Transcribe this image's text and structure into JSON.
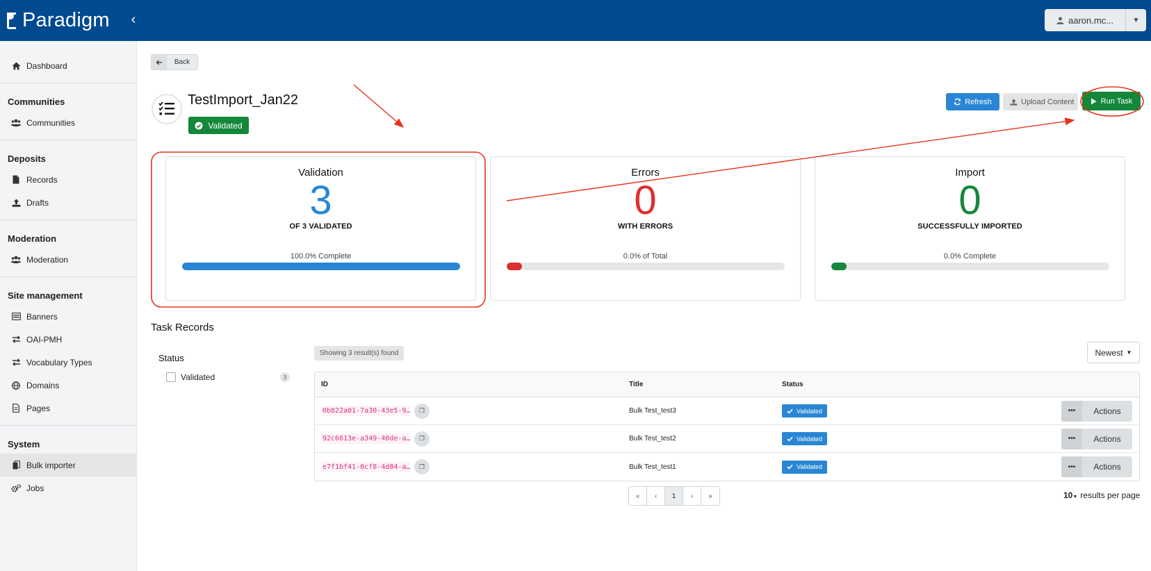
{
  "header": {
    "brand": "Paradigm",
    "collapse_glyph": "‹",
    "user_label": "aaron.mc..."
  },
  "sidebar": {
    "dashboard": "Dashboard",
    "sections": [
      {
        "heading": "Communities",
        "items": [
          "Communities"
        ]
      },
      {
        "heading": "Deposits",
        "items": [
          "Records",
          "Drafts"
        ]
      },
      {
        "heading": "Moderation",
        "items": [
          "Moderation"
        ]
      },
      {
        "heading": "Site management",
        "items": [
          "Banners",
          "OAI-PMH",
          "Vocabulary Types",
          "Domains",
          "Pages"
        ]
      },
      {
        "heading": "System",
        "items": [
          "Bulk importer",
          "Jobs"
        ]
      }
    ]
  },
  "toolbar": {
    "back": "Back",
    "refresh": "Refresh",
    "upload": "Upload Content",
    "run": "Run Task"
  },
  "task": {
    "title": "TestImport_Jan22",
    "status": "Validated"
  },
  "cards": [
    {
      "title": "Validation",
      "number": "3",
      "sub": "OF 3 VALIDATED",
      "progress_label": "100.0% Complete",
      "progress": 1.0,
      "color": "#2a86d4"
    },
    {
      "title": "Errors",
      "number": "0",
      "sub": "WITH ERRORS",
      "progress_label": "0.0% of Total",
      "progress": 0.0,
      "color": "#dc2f2f"
    },
    {
      "title": "Import",
      "number": "0",
      "sub": "SUCCESSFULLY IMPORTED",
      "progress_label": "0.0% Complete",
      "progress": 0.0,
      "color": "#14873a"
    }
  ],
  "records": {
    "section_title": "Task Records",
    "filter_heading": "Status",
    "filter_label": "Validated",
    "filter_count": "3",
    "showing": "Showing 3 result(s) found",
    "sort": "Newest",
    "columns": {
      "id": "ID",
      "title": "Title",
      "status": "Status"
    },
    "rows": [
      {
        "id": "0b822a01-7a30-43e5-9…",
        "title": "Bulk Test_test3",
        "status": "Validated",
        "action": "Actions"
      },
      {
        "id": "92c6613e-a349-40de-a…",
        "title": "Bulk Test_test2",
        "status": "Validated",
        "action": "Actions"
      },
      {
        "id": "e7f1bf41-0cf8-4d84-a…",
        "title": "Bulk Test_test1",
        "status": "Validated",
        "action": "Actions"
      }
    ],
    "pager": {
      "first": "«",
      "prev": "‹",
      "current": "1",
      "next": "›",
      "last": "»"
    },
    "per_page_value": "10",
    "per_page_label": "results per page"
  },
  "colors": {
    "topbar": "#014a8f",
    "primary": "#2a86d4",
    "success": "#14873a",
    "danger": "#dc2f2f",
    "annotation": "#e8331c"
  }
}
